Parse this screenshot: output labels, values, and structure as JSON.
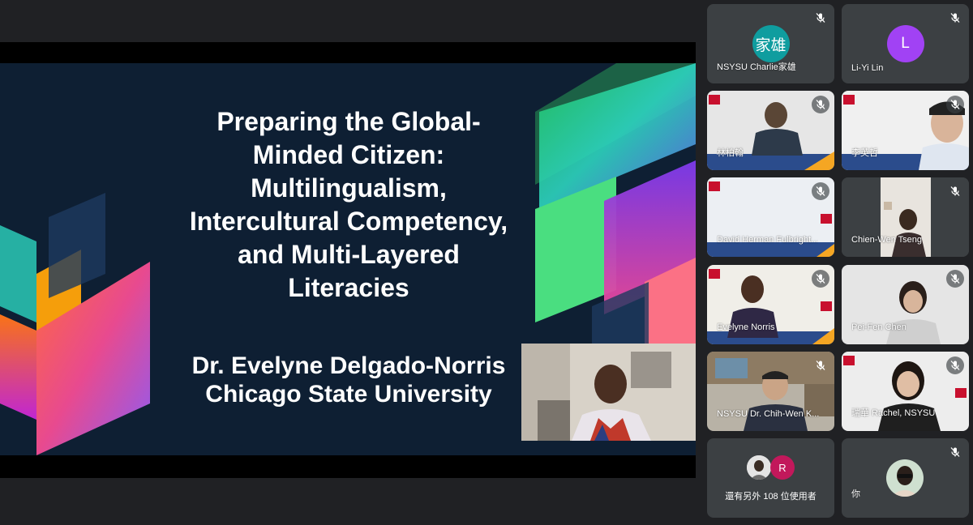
{
  "slide": {
    "title_lines": [
      "Preparing the Global-",
      "Minded Citizen:",
      "Multilingualism,",
      "Intercultural Competency,",
      "and Multi-Layered",
      "Literacies"
    ],
    "author_lines": [
      "Dr. Evelyne Delgado-Norris",
      "Chicago State University"
    ]
  },
  "participants": [
    {
      "name": "NSYSU Charlie家雄",
      "avatar_text": "家雄",
      "avatar_color": "#0f9d9f",
      "muted": true
    },
    {
      "name": "Li-Yi Lin",
      "avatar_text": "L",
      "avatar_color": "#a142f4",
      "muted": true
    },
    {
      "name": "林柏翰",
      "muted": true
    },
    {
      "name": "李英哲",
      "muted": true
    },
    {
      "name": "David Herman Fulbright...",
      "muted": true
    },
    {
      "name": "Chien-Wen Tseng",
      "muted": true
    },
    {
      "name": "Evelyne Norris",
      "muted": true
    },
    {
      "name": "Pei-Fen Chen",
      "muted": true
    },
    {
      "name": "NSYSU Dr. Chih-Wen K...",
      "muted": true
    },
    {
      "name": "瑞華 Rachel, NSYSU",
      "muted": true
    },
    {
      "name": "還有另外 108 位使用者",
      "avatar_text": "R",
      "avatar_color": "#c2185b"
    },
    {
      "name": "你",
      "muted": true
    }
  ],
  "colors": {
    "background": "#202124",
    "tile": "#3c4043",
    "slide": "#0e1f33"
  }
}
